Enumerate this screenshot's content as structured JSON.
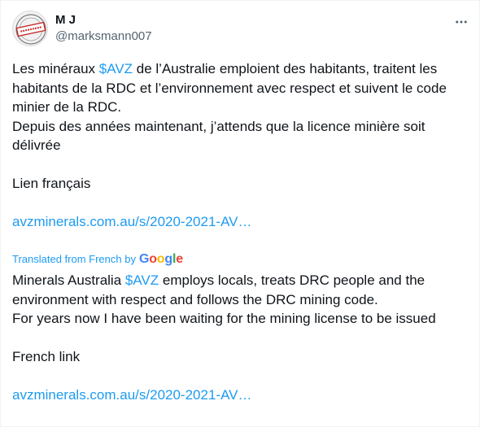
{
  "author": {
    "display_name": "M J",
    "handle": "@marksmann007",
    "avatar_stamp": "CLASSIFIED"
  },
  "original": {
    "line1_pre": "Les minéraux ",
    "cashtag": "$AVZ",
    "line1_post": " de l’Australie emploient des habitants, traitent les habitants de la RDC et l’environnement avec respect et suivent le code minier de la RDC.",
    "line2": "Depuis des années maintenant, j’attends que la licence minière soit délivrée",
    "line3": "Lien français",
    "link": "avzminerals.com.au/s/2020-2021-AV…"
  },
  "translation": {
    "label": "Translated from French by",
    "provider": "Google",
    "line1_pre": "Minerals Australia ",
    "cashtag": "$AVZ",
    "line1_post": " employs locals, treats DRC people and the environment with respect and follows the DRC mining code.",
    "line2": "For years now I have been waiting for the mining license to be issued",
    "line3": "French link",
    "link": "avzminerals.com.au/s/2020-2021-AV…"
  },
  "colors": {
    "link": "#1d9bf0",
    "text": "#0f1419",
    "secondary": "#536471"
  },
  "icons": {
    "more": "more-dots-icon",
    "avatar": "classified-stamp-avatar"
  }
}
